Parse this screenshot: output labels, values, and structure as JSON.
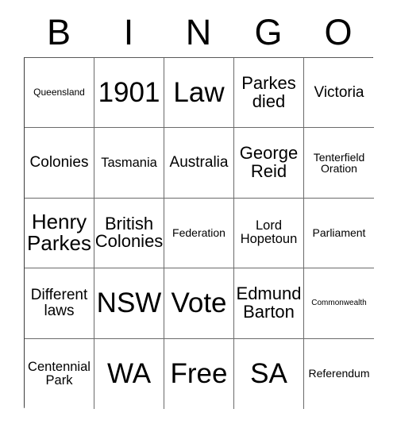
{
  "card": {
    "title": "BINGO",
    "header_letters": [
      "B",
      "I",
      "N",
      "G",
      "O"
    ],
    "grid_size": "5x5",
    "colors": {
      "background": "#ffffff",
      "text": "#000000",
      "grid_line": "#6b6b6b",
      "outer_border": "#808080"
    },
    "rows": [
      {
        "cells": [
          {
            "text": "Queensland",
            "size": "sz-s"
          },
          {
            "text": "1901",
            "size": "sz-xxxl"
          },
          {
            "text": "Law",
            "size": "sz-xxxl"
          },
          {
            "text": "Parkes\ndied",
            "size": "sz-l"
          },
          {
            "text": "Victoria",
            "size": "sz-ml"
          }
        ]
      },
      {
        "cells": [
          {
            "text": "Colonies",
            "size": "sz-ml"
          },
          {
            "text": "Tasmania",
            "size": "sz-m"
          },
          {
            "text": "Australia",
            "size": "sz-ml"
          },
          {
            "text": "George\nReid",
            "size": "sz-l"
          },
          {
            "text": "Tenterfield\nOration",
            "size": "sz-sm"
          }
        ]
      },
      {
        "cells": [
          {
            "text": "Henry\nParkes",
            "size": "sz-xl"
          },
          {
            "text": "British\nColonies",
            "size": "sz-l"
          },
          {
            "text": "Federation",
            "size": "sz-sm"
          },
          {
            "text": "Lord\nHopetoun",
            "size": "sz-m"
          },
          {
            "text": "Parliament",
            "size": "sz-sm"
          }
        ]
      },
      {
        "cells": [
          {
            "text": "Different\nlaws",
            "size": "sz-ml"
          },
          {
            "text": "NSW",
            "size": "sz-xxxl"
          },
          {
            "text": "Vote",
            "size": "sz-xxxl"
          },
          {
            "text": "Edmund\nBarton",
            "size": "sz-l"
          },
          {
            "text": "Commonwealth",
            "size": "sz-xs"
          }
        ]
      },
      {
        "cells": [
          {
            "text": "Centennial\nPark",
            "size": "sz-m"
          },
          {
            "text": "WA",
            "size": "sz-xxxl"
          },
          {
            "text": "Free",
            "size": "sz-xxxl"
          },
          {
            "text": "SA",
            "size": "sz-xxxl"
          },
          {
            "text": "Referendum",
            "size": "sz-sm"
          }
        ]
      }
    ]
  }
}
